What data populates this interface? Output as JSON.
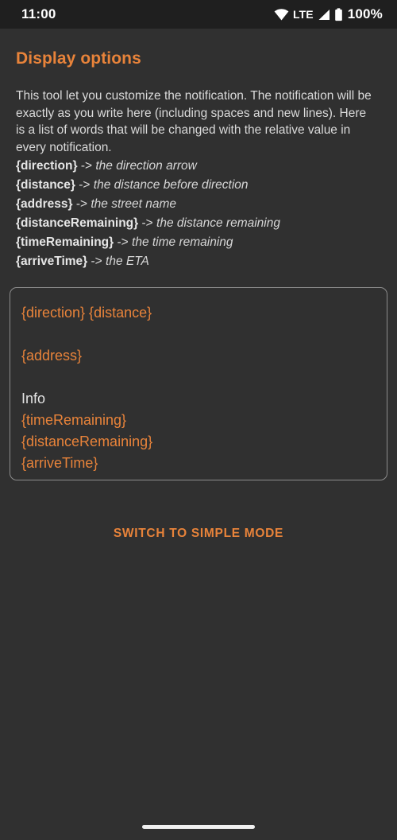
{
  "status_bar": {
    "clock": "11:00",
    "wifi_icon": "wifi-icon",
    "network_label": "LTE",
    "signal_icon": "cellular-signal-icon",
    "battery_icon": "battery-full-icon",
    "battery_percent": "100%"
  },
  "screen": {
    "title": "Display options",
    "description": "This tool let you customize the notification. The notification will be exactly as you write here (including spaces and new lines). Here is a list of words that will be changed with the relative value in every notification."
  },
  "tokens": [
    {
      "key": "{direction}",
      "arrow": "->",
      "description": "the direction arrow"
    },
    {
      "key": "{distance}",
      "arrow": "->",
      "description": "the distance before direction"
    },
    {
      "key": "{address}",
      "arrow": "->",
      "description": "the street name"
    },
    {
      "key": "{distanceRemaining}",
      "arrow": "->",
      "description": "the distance remaining"
    },
    {
      "key": "{timeRemaining}",
      "arrow": "->",
      "description": "the time remaining"
    },
    {
      "key": "{arriveTime}",
      "arrow": "->",
      "description": "the ETA"
    }
  ],
  "editor": {
    "lines": [
      {
        "text": "{direction} {distance}",
        "style": "token"
      },
      {
        "text": "",
        "style": "blank"
      },
      {
        "text": "{address}",
        "style": "token"
      },
      {
        "text": "",
        "style": "blank"
      },
      {
        "text": "Info",
        "style": "plain"
      },
      {
        "text": "{timeRemaining}",
        "style": "token"
      },
      {
        "text": "{distanceRemaining}",
        "style": "token"
      },
      {
        "text": "{arriveTime}",
        "style": "token"
      }
    ]
  },
  "actions": {
    "switch_mode_label": "SWITCH TO SIMPLE MODE"
  },
  "colors": {
    "accent_orange": "#e8833a",
    "background": "#303030",
    "status_bar_background": "#1f1f1f",
    "body_text": "#dadada",
    "editor_border": "#8c8c8c"
  }
}
